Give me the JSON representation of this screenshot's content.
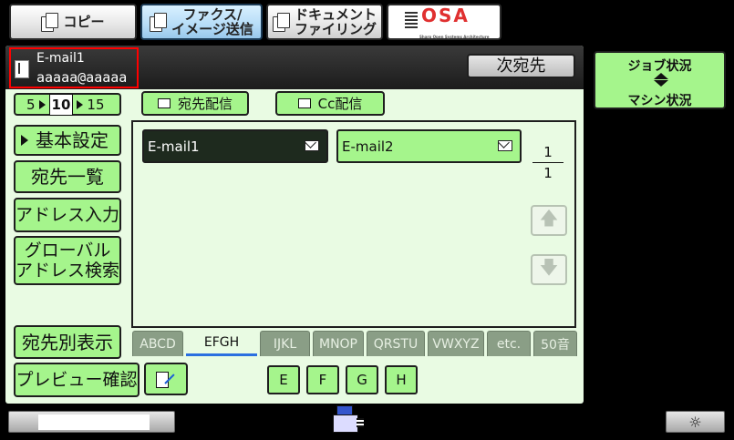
{
  "tabs": [
    {
      "id": "copy",
      "label": "コピー",
      "icon": "copy-icon"
    },
    {
      "id": "fax",
      "label_line1": "ファクス/",
      "label_line2": "イメージ送信",
      "icon": "fax-scan-icon"
    },
    {
      "id": "filing",
      "label_line1": "ドキュメント",
      "label_line2": "ファイリング",
      "icon": "document-filing-icon"
    },
    {
      "id": "osa",
      "label": "OSA",
      "sublabel": "Sharp Open Systems Architecture"
    }
  ],
  "header": {
    "dest_name": "E-mail1",
    "dest_addr": "aaaaa@aaaaa",
    "next_button": "次宛先"
  },
  "side": {
    "job_status": "ジョブ状況",
    "machine_status": "マシン状況"
  },
  "count_selector": {
    "v1": "5",
    "v2": "10",
    "v3": "15"
  },
  "modes": {
    "to": "宛先配信",
    "cc": "Cc配信"
  },
  "left_menu": {
    "basic": "基本設定",
    "list": "宛先一覧",
    "addr_input": "アドレス入力",
    "global_line1": "グローバル",
    "global_line2": "アドレス検索",
    "per_dest": "宛先別表示",
    "preview": "プレビュー確認"
  },
  "entries": [
    {
      "label": "E-mail1",
      "selected": true
    },
    {
      "label": "E-mail2",
      "selected": false
    }
  ],
  "pager": {
    "current": "1",
    "total": "1"
  },
  "index_tabs": [
    "ABCD",
    "EFGH",
    "IJKL",
    "MNOP",
    "QRSTU",
    "VWXYZ",
    "etc.",
    "50音"
  ],
  "selected_index": "EFGH",
  "letters": [
    "E",
    "F",
    "G",
    "H"
  ],
  "colors": {
    "accent_green": "#a5f58c",
    "panel_bg": "#e9fbe3",
    "selection_red": "#ff0000"
  }
}
